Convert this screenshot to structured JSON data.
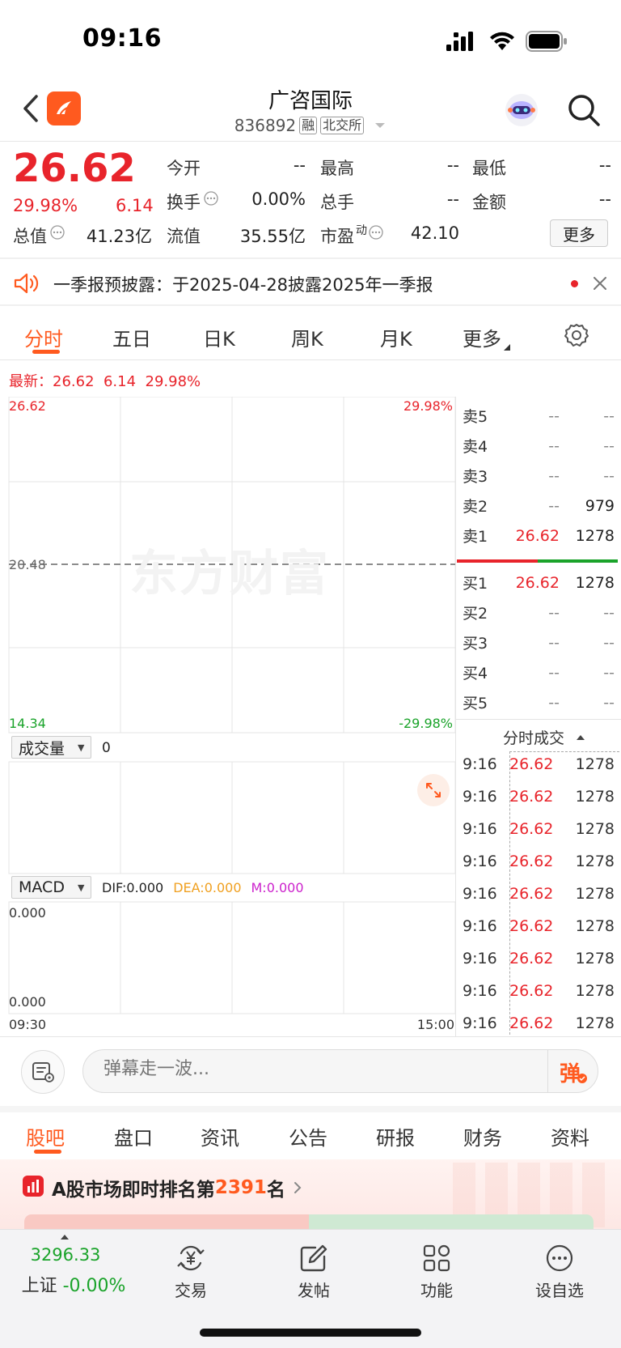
{
  "status": {
    "time": "09:16"
  },
  "header": {
    "name": "广咨国际",
    "code": "836892",
    "margin_tag": "融",
    "exchange_tag": "北交所"
  },
  "quote": {
    "price": "26.62",
    "change_pct": "29.98%",
    "change": "6.14",
    "fields": {
      "open_label": "今开",
      "open_value": "--",
      "high_label": "最高",
      "high_value": "--",
      "low_label": "最低",
      "low_value": "--",
      "turnover_label": "换手",
      "turnover_value": "0.00%",
      "volume_label": "总手",
      "volume_value": "--",
      "amount_label": "金额",
      "amount_value": "--",
      "mktcap_label": "总值",
      "mktcap_value": "41.23亿",
      "float_label": "流值",
      "float_value": "35.55亿",
      "pe_label": "市盈",
      "pe_sup": "动",
      "pe_value": "42.10"
    },
    "more_label": "更多"
  },
  "notice": {
    "text": "一季报预披露：于2025-04-28披露2025年一季报"
  },
  "chart_tabs": [
    "分时",
    "五日",
    "日K",
    "周K",
    "月K",
    "更多"
  ],
  "chart": {
    "latest_label": "最新：",
    "latest_price": "26.62",
    "latest_change": "6.14",
    "latest_pct": "29.98%",
    "top_price": "26.62",
    "top_pct": "29.98%",
    "mid_price": "20.48",
    "bottom_price": "14.34",
    "bottom_pct": "-29.98%",
    "watermark": "东方财富",
    "volume_selector": "成交量",
    "volume_value": "0",
    "macd_selector": "MACD",
    "dif": "DIF:0.000",
    "dea": "DEA:0.000",
    "m": "M:0.000",
    "macd_top": "0.000",
    "macd_bottom": "0.000",
    "time_start": "09:30",
    "time_end": "15:00"
  },
  "order_book": {
    "asks": [
      {
        "label": "卖5",
        "price": "--",
        "vol": "--"
      },
      {
        "label": "卖4",
        "price": "--",
        "vol": "--"
      },
      {
        "label": "卖3",
        "price": "--",
        "vol": "--"
      },
      {
        "label": "卖2",
        "price": "--",
        "vol": "979"
      },
      {
        "label": "卖1",
        "price": "26.62",
        "vol": "1278"
      }
    ],
    "bids": [
      {
        "label": "买1",
        "price": "26.62",
        "vol": "1278"
      },
      {
        "label": "买2",
        "price": "--",
        "vol": "--"
      },
      {
        "label": "买3",
        "price": "--",
        "vol": "--"
      },
      {
        "label": "买4",
        "price": "--",
        "vol": "--"
      },
      {
        "label": "买5",
        "price": "--",
        "vol": "--"
      }
    ],
    "trades_title": "分时成交",
    "trades": [
      {
        "t": "9:16",
        "p": "26.62",
        "v": "1278"
      },
      {
        "t": "9:16",
        "p": "26.62",
        "v": "1278"
      },
      {
        "t": "9:16",
        "p": "26.62",
        "v": "1278"
      },
      {
        "t": "9:16",
        "p": "26.62",
        "v": "1278"
      },
      {
        "t": "9:16",
        "p": "26.62",
        "v": "1278"
      },
      {
        "t": "9:16",
        "p": "26.62",
        "v": "1278"
      },
      {
        "t": "9:16",
        "p": "26.62",
        "v": "1278"
      },
      {
        "t": "9:16",
        "p": "26.62",
        "v": "1278"
      },
      {
        "t": "9:16",
        "p": "26.62",
        "v": "1278"
      }
    ]
  },
  "danmu": {
    "placeholder": "弹幕走一波...",
    "button": "弹"
  },
  "bottom_tabs": [
    "股吧",
    "盘口",
    "资讯",
    "公告",
    "研报",
    "财务",
    "资料"
  ],
  "rank": {
    "prefix": "A股市场即时排名第",
    "number": "2391",
    "suffix": "名"
  },
  "nav": {
    "index_value": "3296.33",
    "index_name": "上证",
    "index_change": "-0.00%",
    "items": [
      "交易",
      "发帖",
      "功能",
      "设自选"
    ]
  }
}
